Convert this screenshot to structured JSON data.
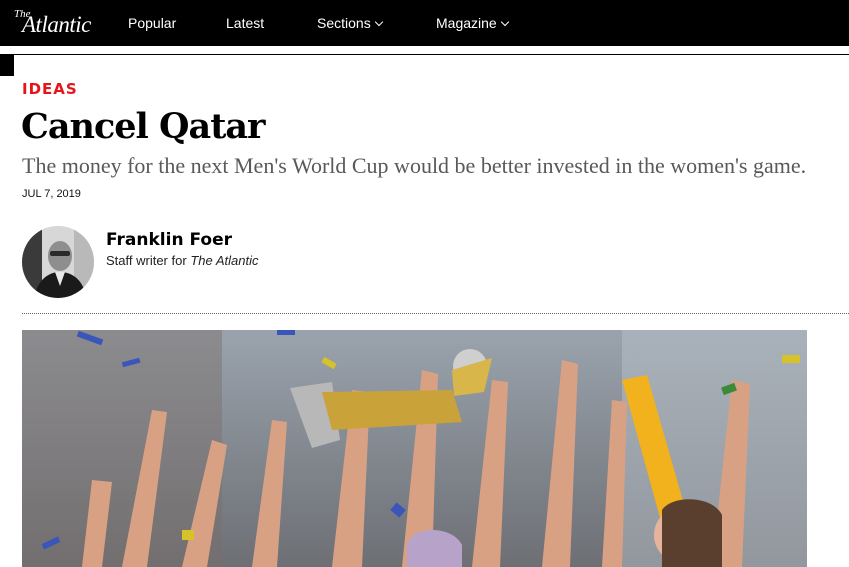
{
  "brand": {
    "logo_the": "The",
    "logo_name": "Atlantic"
  },
  "nav": {
    "items": [
      "Popular",
      "Latest",
      "Sections",
      "Magazine"
    ]
  },
  "article": {
    "section": "IDEAS",
    "title": "Cancel Qatar",
    "dek": "The money for the next Men's World Cup would be better invested in the women's game.",
    "date": "JUL 7, 2019"
  },
  "author": {
    "name": "Franklin Foer",
    "role_prefix": "Staff writer for",
    "role_pub": "The Atlantic"
  },
  "colors": {
    "kicker": "#e7131a",
    "topbar": "#000000",
    "dek": "#595959"
  },
  "icons": {
    "sections_chevron": "chevron-down-icon",
    "magazine_chevron": "chevron-down-icon"
  }
}
